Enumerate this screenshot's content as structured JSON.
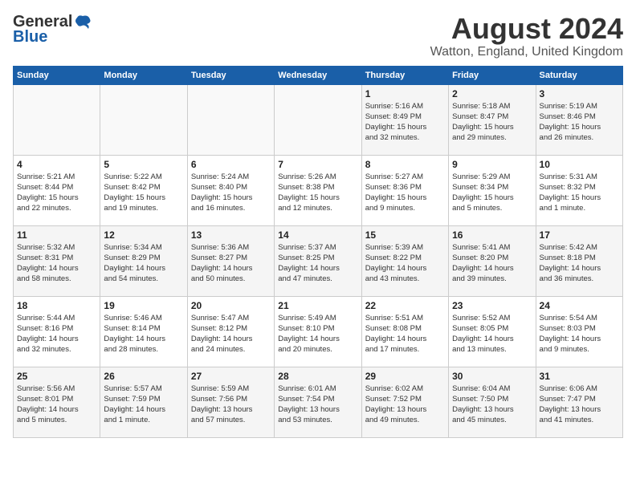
{
  "header": {
    "logo_general": "General",
    "logo_blue": "Blue",
    "title": "August 2024",
    "subtitle": "Watton, England, United Kingdom"
  },
  "columns": [
    "Sunday",
    "Monday",
    "Tuesday",
    "Wednesday",
    "Thursday",
    "Friday",
    "Saturday"
  ],
  "weeks": [
    [
      {
        "day": "",
        "info": ""
      },
      {
        "day": "",
        "info": ""
      },
      {
        "day": "",
        "info": ""
      },
      {
        "day": "",
        "info": ""
      },
      {
        "day": "1",
        "info": "Sunrise: 5:16 AM\nSunset: 8:49 PM\nDaylight: 15 hours\nand 32 minutes."
      },
      {
        "day": "2",
        "info": "Sunrise: 5:18 AM\nSunset: 8:47 PM\nDaylight: 15 hours\nand 29 minutes."
      },
      {
        "day": "3",
        "info": "Sunrise: 5:19 AM\nSunset: 8:46 PM\nDaylight: 15 hours\nand 26 minutes."
      }
    ],
    [
      {
        "day": "4",
        "info": "Sunrise: 5:21 AM\nSunset: 8:44 PM\nDaylight: 15 hours\nand 22 minutes."
      },
      {
        "day": "5",
        "info": "Sunrise: 5:22 AM\nSunset: 8:42 PM\nDaylight: 15 hours\nand 19 minutes."
      },
      {
        "day": "6",
        "info": "Sunrise: 5:24 AM\nSunset: 8:40 PM\nDaylight: 15 hours\nand 16 minutes."
      },
      {
        "day": "7",
        "info": "Sunrise: 5:26 AM\nSunset: 8:38 PM\nDaylight: 15 hours\nand 12 minutes."
      },
      {
        "day": "8",
        "info": "Sunrise: 5:27 AM\nSunset: 8:36 PM\nDaylight: 15 hours\nand 9 minutes."
      },
      {
        "day": "9",
        "info": "Sunrise: 5:29 AM\nSunset: 8:34 PM\nDaylight: 15 hours\nand 5 minutes."
      },
      {
        "day": "10",
        "info": "Sunrise: 5:31 AM\nSunset: 8:32 PM\nDaylight: 15 hours\nand 1 minute."
      }
    ],
    [
      {
        "day": "11",
        "info": "Sunrise: 5:32 AM\nSunset: 8:31 PM\nDaylight: 14 hours\nand 58 minutes."
      },
      {
        "day": "12",
        "info": "Sunrise: 5:34 AM\nSunset: 8:29 PM\nDaylight: 14 hours\nand 54 minutes."
      },
      {
        "day": "13",
        "info": "Sunrise: 5:36 AM\nSunset: 8:27 PM\nDaylight: 14 hours\nand 50 minutes."
      },
      {
        "day": "14",
        "info": "Sunrise: 5:37 AM\nSunset: 8:25 PM\nDaylight: 14 hours\nand 47 minutes."
      },
      {
        "day": "15",
        "info": "Sunrise: 5:39 AM\nSunset: 8:22 PM\nDaylight: 14 hours\nand 43 minutes."
      },
      {
        "day": "16",
        "info": "Sunrise: 5:41 AM\nSunset: 8:20 PM\nDaylight: 14 hours\nand 39 minutes."
      },
      {
        "day": "17",
        "info": "Sunrise: 5:42 AM\nSunset: 8:18 PM\nDaylight: 14 hours\nand 36 minutes."
      }
    ],
    [
      {
        "day": "18",
        "info": "Sunrise: 5:44 AM\nSunset: 8:16 PM\nDaylight: 14 hours\nand 32 minutes."
      },
      {
        "day": "19",
        "info": "Sunrise: 5:46 AM\nSunset: 8:14 PM\nDaylight: 14 hours\nand 28 minutes."
      },
      {
        "day": "20",
        "info": "Sunrise: 5:47 AM\nSunset: 8:12 PM\nDaylight: 14 hours\nand 24 minutes."
      },
      {
        "day": "21",
        "info": "Sunrise: 5:49 AM\nSunset: 8:10 PM\nDaylight: 14 hours\nand 20 minutes."
      },
      {
        "day": "22",
        "info": "Sunrise: 5:51 AM\nSunset: 8:08 PM\nDaylight: 14 hours\nand 17 minutes."
      },
      {
        "day": "23",
        "info": "Sunrise: 5:52 AM\nSunset: 8:05 PM\nDaylight: 14 hours\nand 13 minutes."
      },
      {
        "day": "24",
        "info": "Sunrise: 5:54 AM\nSunset: 8:03 PM\nDaylight: 14 hours\nand 9 minutes."
      }
    ],
    [
      {
        "day": "25",
        "info": "Sunrise: 5:56 AM\nSunset: 8:01 PM\nDaylight: 14 hours\nand 5 minutes."
      },
      {
        "day": "26",
        "info": "Sunrise: 5:57 AM\nSunset: 7:59 PM\nDaylight: 14 hours\nand 1 minute."
      },
      {
        "day": "27",
        "info": "Sunrise: 5:59 AM\nSunset: 7:56 PM\nDaylight: 13 hours\nand 57 minutes."
      },
      {
        "day": "28",
        "info": "Sunrise: 6:01 AM\nSunset: 7:54 PM\nDaylight: 13 hours\nand 53 minutes."
      },
      {
        "day": "29",
        "info": "Sunrise: 6:02 AM\nSunset: 7:52 PM\nDaylight: 13 hours\nand 49 minutes."
      },
      {
        "day": "30",
        "info": "Sunrise: 6:04 AM\nSunset: 7:50 PM\nDaylight: 13 hours\nand 45 minutes."
      },
      {
        "day": "31",
        "info": "Sunrise: 6:06 AM\nSunset: 7:47 PM\nDaylight: 13 hours\nand 41 minutes."
      }
    ]
  ]
}
